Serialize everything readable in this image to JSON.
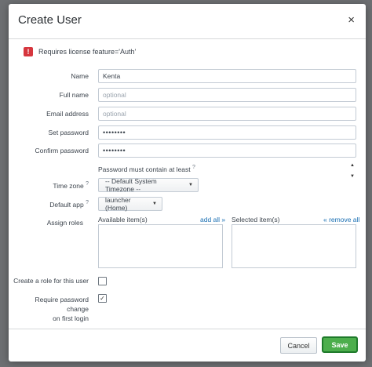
{
  "dialog": {
    "title": "Create User",
    "close_glyph": "×",
    "notice_icon_glyph": "!",
    "notice_text": "Requires license feature='Auth'"
  },
  "form": {
    "name": {
      "label": "Name",
      "value": "Kenta"
    },
    "full_name": {
      "label": "Full name",
      "placeholder": "optional"
    },
    "email": {
      "label": "Email address",
      "placeholder": "optional"
    },
    "set_password": {
      "label": "Set password",
      "value": "••••••••"
    },
    "confirm_password": {
      "label": "Confirm password",
      "value": "••••••••"
    },
    "password_note": "Password must contain at least",
    "help_glyph": "?",
    "time_zone": {
      "label": "Time zone",
      "value": "-- Default System Timezone --"
    },
    "default_app": {
      "label": "Default app",
      "value": "launcher (Home)"
    },
    "assign_roles": {
      "label": "Assign roles",
      "available_label": "Available item(s)",
      "add_all": "add all »",
      "selected_label": "Selected item(s)",
      "remove_all": "« remove all"
    },
    "create_role": {
      "label": "Create a role for this user",
      "checked": false
    },
    "require_change": {
      "label_line1": "Require password change",
      "label_line2": "on first login",
      "checked": true,
      "check_glyph": "✓"
    }
  },
  "footer": {
    "cancel_label": "Cancel",
    "save_label": "Save"
  },
  "colors": {
    "error": "#d6363e",
    "link": "#1a6fb3",
    "save": "#4cae4c",
    "save_border": "#1e7a2a"
  }
}
